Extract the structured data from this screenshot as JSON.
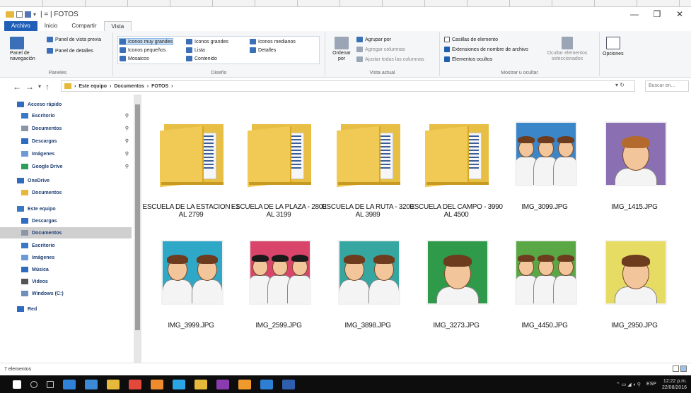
{
  "window": {
    "title": "FOTOS",
    "controls": [
      "—",
      "❐",
      "✕"
    ]
  },
  "tabs": [
    "Archivo",
    "Inicio",
    "Compartir",
    "Vista"
  ],
  "ribbon": {
    "panes": {
      "nav_pane": "Panel de navegación",
      "preview": "Panel de vista previa",
      "details": "Panel de detalles",
      "label": "Paneles"
    },
    "layout": {
      "items": [
        "Iconos muy grandes",
        "Iconos grandes",
        "Iconos medianos",
        "Iconos pequeños",
        "Lista",
        "Detalles",
        "Mosaicos",
        "Contenido"
      ],
      "label": "Diseño"
    },
    "current_view": {
      "sort_by": "Ordenar por",
      "group_by": "Agrupar por",
      "add_columns": "Agregar columnas",
      "fit_columns": "Ajustar todas las columnas",
      "label": "Vista actual"
    },
    "show_hide": {
      "checkboxes": "Casillas de elemento",
      "extensions": "Extensiones de nombre de archivo",
      "hidden_items": "Elementos ocultos",
      "hide_selected": "Ocultar elementos seleccionados",
      "label": "Mostrar u ocultar"
    },
    "options": "Opciones"
  },
  "address": {
    "path": [
      "Este equipo",
      "Documentos",
      "FOTOS"
    ],
    "search_placeholder": "Buscar en..."
  },
  "navpane": {
    "items": [
      {
        "label": "Acceso rápido",
        "pinned": false
      },
      {
        "label": "Escritorio",
        "pinned": true
      },
      {
        "label": "Documentos",
        "pinned": true
      },
      {
        "label": "Descargas",
        "pinned": true
      },
      {
        "label": "Imágenes",
        "pinned": true
      },
      {
        "label": "Google Drive",
        "pinned": true
      },
      {
        "label": "OneDrive",
        "pinned": false
      },
      {
        "label": "Documentos",
        "pinned": false
      },
      {
        "label": "Este equipo",
        "pinned": false
      },
      {
        "label": "Descargas",
        "pinned": false
      },
      {
        "label": "Documentos",
        "pinned": false
      },
      {
        "label": "Escritorio",
        "pinned": false
      },
      {
        "label": "Imágenes",
        "pinned": false
      },
      {
        "label": "Música",
        "pinned": false
      },
      {
        "label": "Videos",
        "pinned": false
      },
      {
        "label": "Windows (C:)",
        "pinned": false
      },
      {
        "label": "Red",
        "pinned": false
      }
    ]
  },
  "files": [
    {
      "name": "ESCUELA DE LA ESTACION - 1 AL 2799",
      "kind": "folder"
    },
    {
      "name": "ESCUELA DE LA PLAZA - 2800 AL 3199",
      "kind": "folder"
    },
    {
      "name": "ESCUELA DE LA RUTA - 3200 AL 3989",
      "kind": "folder"
    },
    {
      "name": "ESCUELA DEL CAMPO - 3990 AL 4500",
      "kind": "folder"
    },
    {
      "name": "IMG_3099.JPG",
      "kind": "photo",
      "bg": "#3b86c9"
    },
    {
      "name": "IMG_1415.JPG",
      "kind": "photo",
      "bg": "#8a6fb3"
    },
    {
      "name": "IMG_3999.JPG",
      "kind": "photo",
      "bg": "#2fa7c6"
    },
    {
      "name": "IMG_2599.JPG",
      "kind": "photo",
      "bg": "#d9456a"
    },
    {
      "name": "IMG_3898.JPG",
      "kind": "photo",
      "bg": "#35a6a0"
    },
    {
      "name": "IMG_3273.JPG",
      "kind": "photo",
      "bg": "#2f9a4a"
    },
    {
      "name": "IMG_4450.JPG",
      "kind": "photo",
      "bg": "#5aa745"
    },
    {
      "name": "IMG_2950.JPG",
      "kind": "photo",
      "bg": "#e6dc63"
    }
  ],
  "status": {
    "count": "7 elementos"
  },
  "taskbar": {
    "icons": [
      {
        "name": "windows-start-icon",
        "color": "#ffffff"
      },
      {
        "name": "search-icon",
        "color": "#cfcfcf"
      },
      {
        "name": "task-view-icon",
        "color": "#cfcfcf"
      },
      {
        "name": "edge-icon",
        "color": "#2f82d8"
      },
      {
        "name": "store-icon",
        "color": "#3c8ad6"
      },
      {
        "name": "explorer-icon",
        "color": "#e6b93a"
      },
      {
        "name": "chrome-icon",
        "color": "#e3483b"
      },
      {
        "name": "firefox-icon",
        "color": "#f08b2d"
      },
      {
        "name": "skype-icon",
        "color": "#2aa5e5"
      },
      {
        "name": "folder-icon",
        "color": "#e6b93a"
      },
      {
        "name": "onenote-icon",
        "color": "#8a3bb0"
      },
      {
        "name": "illustrator-icon",
        "color": "#f09a2e"
      },
      {
        "name": "photoshop-icon",
        "color": "#2d7fd3"
      },
      {
        "name": "word-icon",
        "color": "#2f5eae"
      }
    ],
    "clock_time": "12:22 p.m.",
    "clock_date": "22/08/2016",
    "language": "ESP"
  }
}
